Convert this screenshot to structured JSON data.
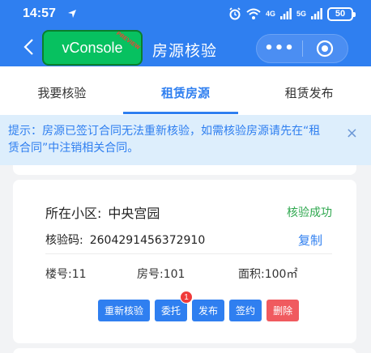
{
  "status_bar": {
    "time": "14:57",
    "net1": "4G",
    "net2": "5G",
    "battery": "50"
  },
  "nav": {
    "vconsole_label": "vConsole",
    "vconsole_ribbon": "PREVIEW",
    "title": "房源核验",
    "menu_dots": "•••"
  },
  "tabs": [
    {
      "label": "我要核验"
    },
    {
      "label": "租赁房源"
    },
    {
      "label": "租赁发布"
    }
  ],
  "notice": {
    "text": "提示：房源已签订合同无法重新核验，如需核验房源请先在“租赁合同”中注销相关合同。",
    "close": "×"
  },
  "house": {
    "community_label": "所在小区:",
    "community_value": "中央宫园",
    "status": "核验成功",
    "code_label": "核验码:",
    "code_value": "2604291456372910",
    "copy_label": "复制",
    "building": "楼号:11",
    "room": "房号:101",
    "area": "面积:100㎡",
    "actions": {
      "reverify": "重新核验",
      "entrust": "委托",
      "entrust_badge": "1",
      "publish": "发布",
      "sign": "签约",
      "delete": "删除"
    }
  },
  "colors": {
    "primary": "#2f7ff0",
    "success": "#2fa84f",
    "danger": "#f05a5f",
    "vconsole": "#07c160"
  }
}
